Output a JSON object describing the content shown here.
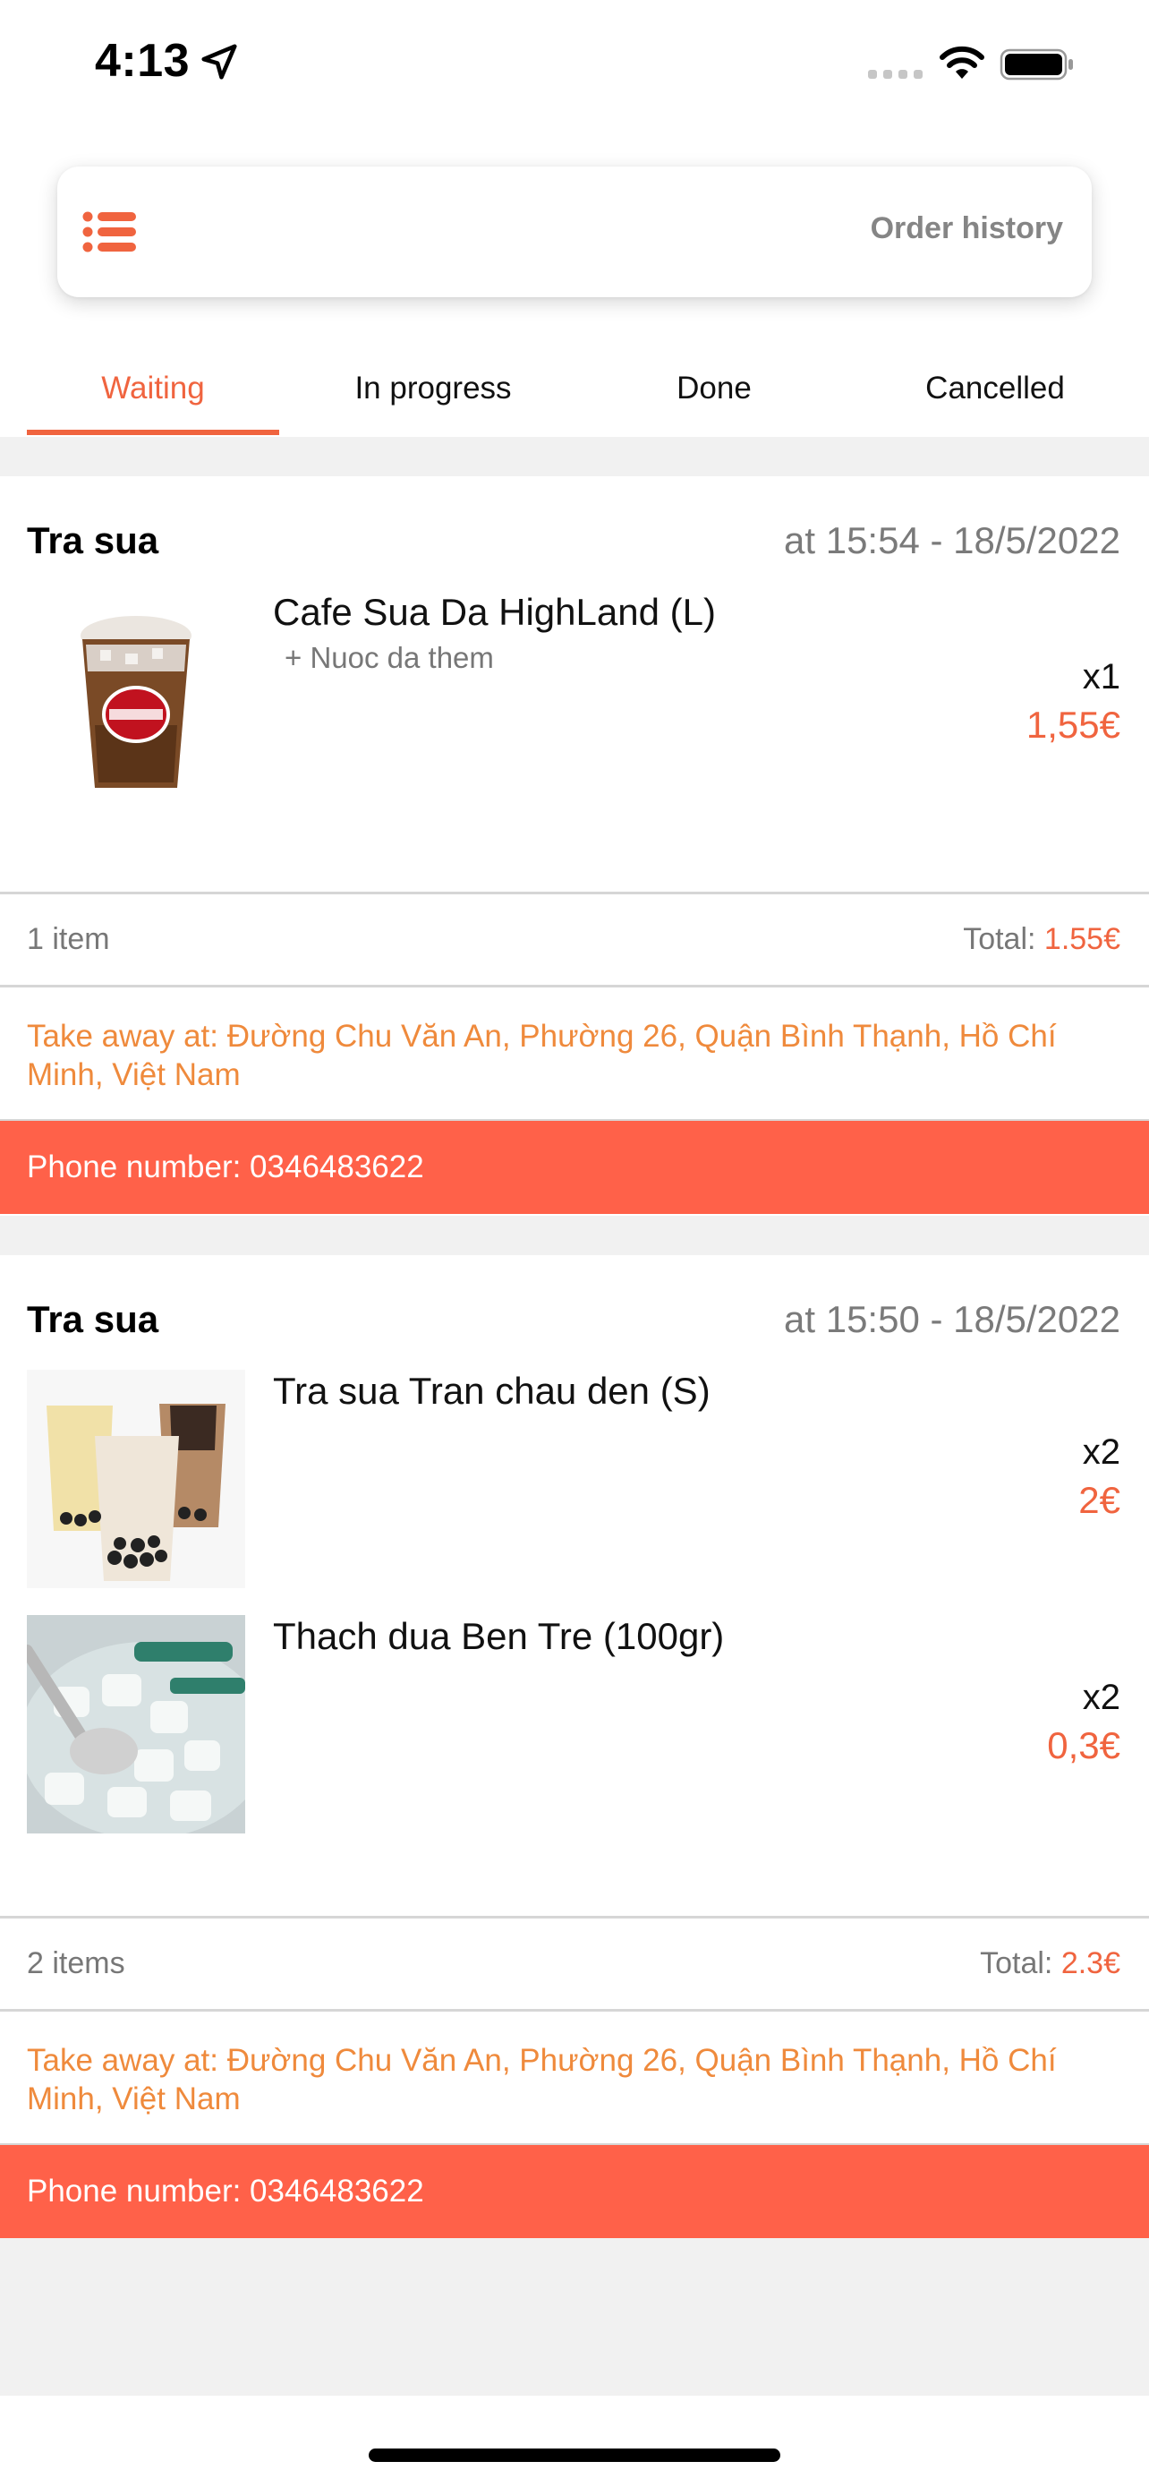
{
  "status_bar": {
    "time": "4:13",
    "icons": [
      "location-arrow-icon",
      "signal-icon",
      "wifi-icon",
      "battery-icon"
    ]
  },
  "header": {
    "menu_icon": "list-icon",
    "title": "Order history"
  },
  "tabs": [
    {
      "label": "Waiting",
      "active": true
    },
    {
      "label": "In progress",
      "active": false
    },
    {
      "label": "Done",
      "active": false
    },
    {
      "label": "Cancelled",
      "active": false
    }
  ],
  "orders": [
    {
      "shop": "Tra sua",
      "time": "at 15:54 - 18/5/2022",
      "items": [
        {
          "name": "Cafe Sua Da HighLand (L)",
          "option": "+ Nuoc da them",
          "qty": "x1",
          "price": "1,55€",
          "image": "highlands-iced-coffee"
        }
      ],
      "count": "1 item",
      "total_label": "Total: ",
      "total_value": "1.55€",
      "address": "Take away at: Đường Chu Văn An, Phường 26, Quận Bình Thạnh, Hồ Chí Minh, Việt Nam",
      "phone": "Phone number: 0346483622"
    },
    {
      "shop": "Tra sua",
      "time": "at 15:50 - 18/5/2022",
      "items": [
        {
          "name": "Tra sua Tran chau den (S)",
          "option": "",
          "qty": "x2",
          "price": "2€",
          "image": "bubble-milk-tea"
        },
        {
          "name": "Thach dua Ben Tre (100gr)",
          "option": "",
          "qty": "x2",
          "price": "0,3€",
          "image": "coconut-jelly"
        }
      ],
      "count": "2 items",
      "total_label": "Total: ",
      "total_value": "2.3€",
      "address": "Take away at: Đường Chu Văn An, Phường 26, Quận Bình Thạnh, Hồ Chí Minh, Việt Nam",
      "phone": "Phone number: 0346483622"
    }
  ],
  "colors": {
    "accent": "#f0643f",
    "phone_bar": "#ff6149",
    "address": "#ef8a3c",
    "band": "#f1f1f1"
  }
}
